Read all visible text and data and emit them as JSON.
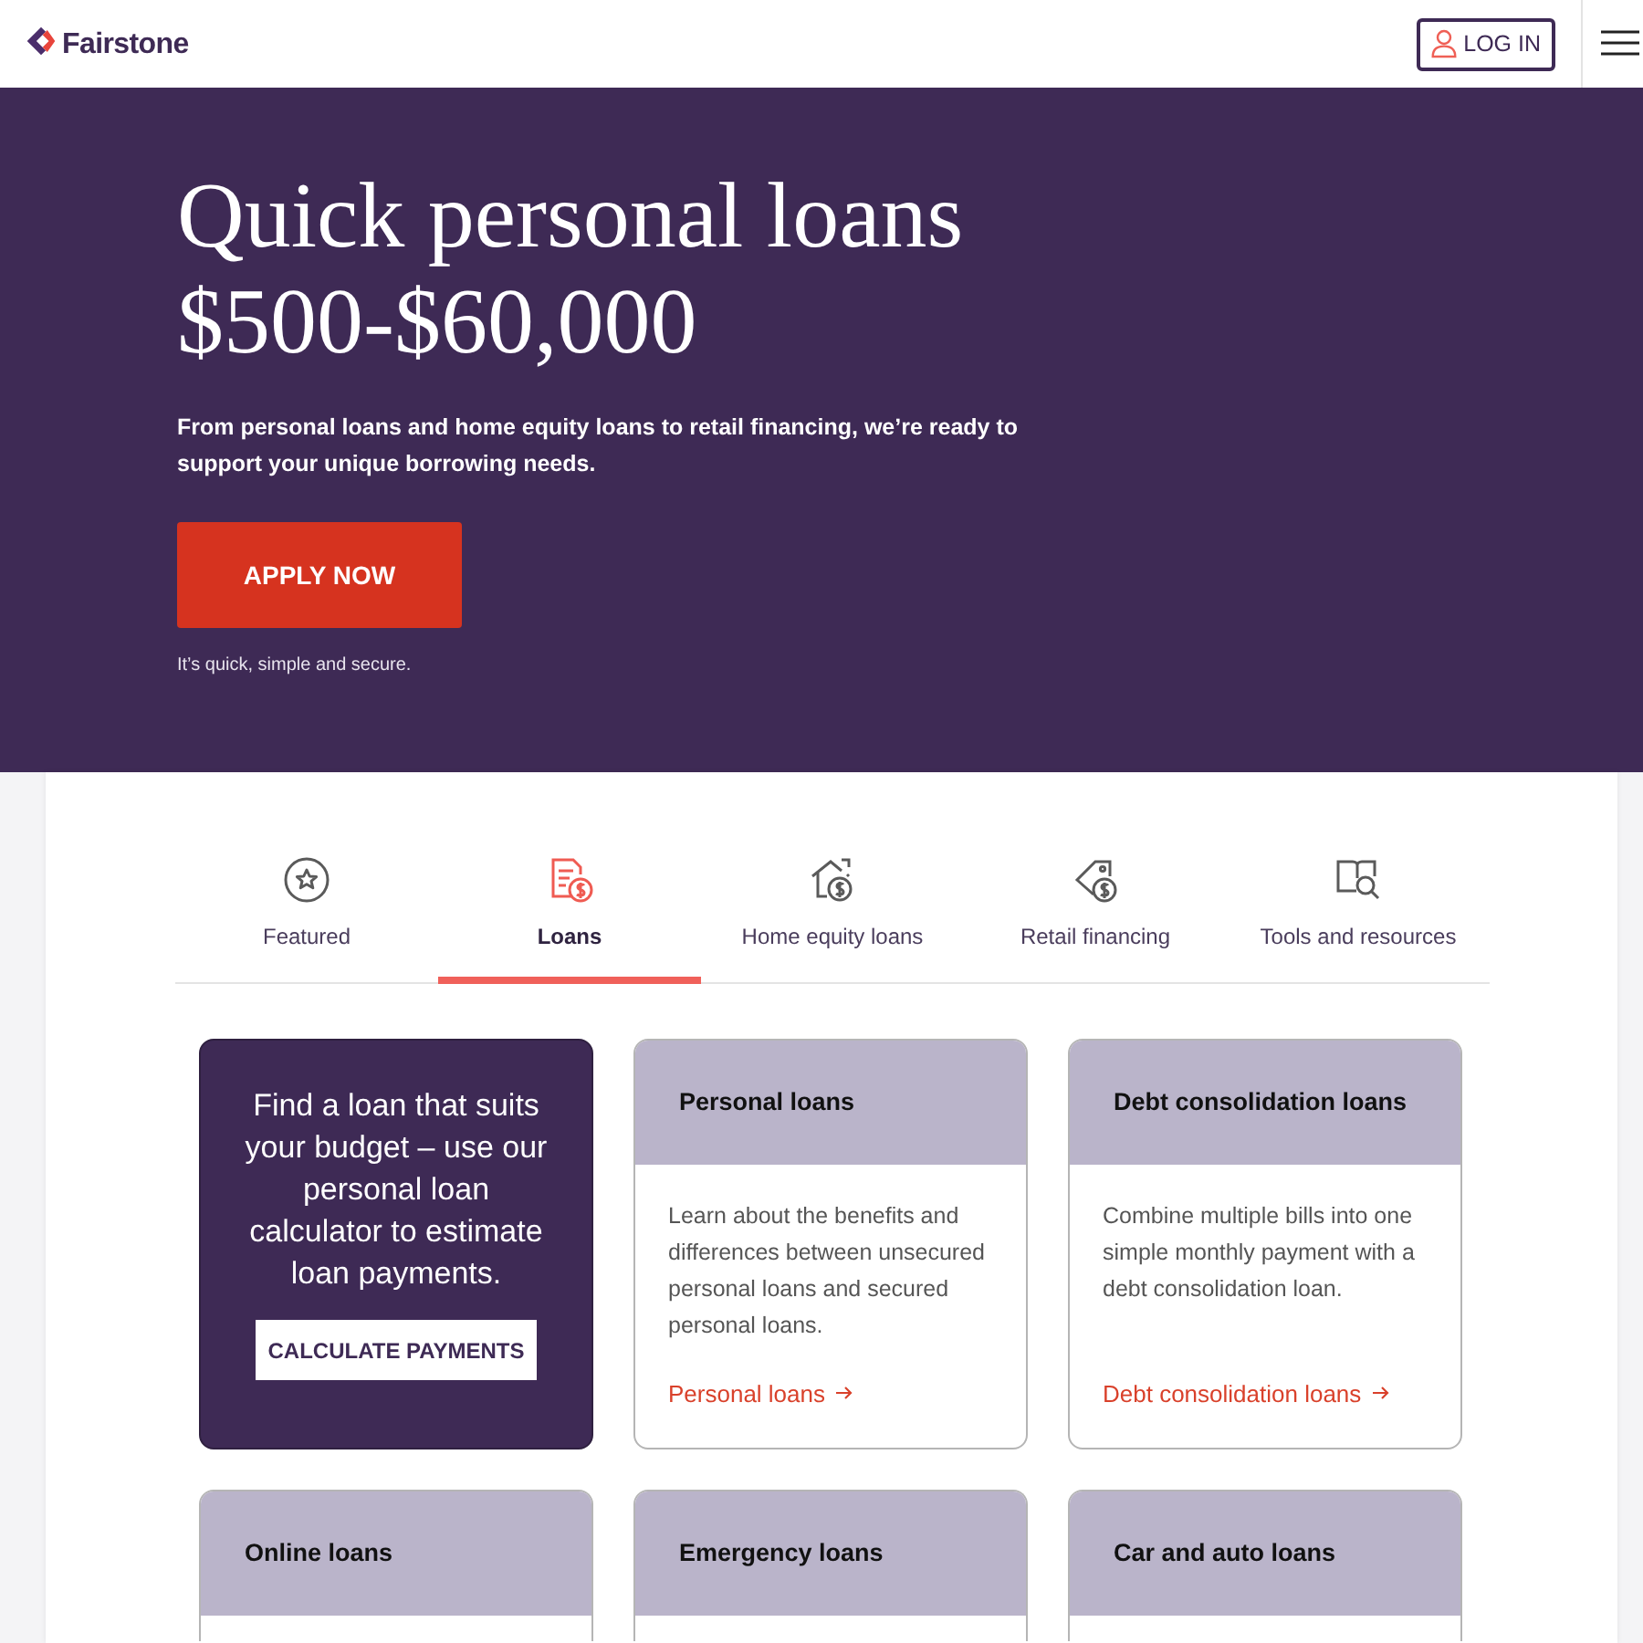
{
  "header": {
    "logo": "Fairstone",
    "login_button": "LOG IN"
  },
  "hero": {
    "title_lines": [
      "Quick personal loans",
      "$500-$60,000"
    ],
    "description": "From personal loans and home equity loans to retail financing, we’re ready to support your unique borrowing needs.",
    "button": "APPLY NOW",
    "note": "It’s quick, simple and secure."
  },
  "tabs": [
    {
      "label": "Featured",
      "selected": false
    },
    {
      "label": "Loans",
      "selected": true
    },
    {
      "label": "Home equity loans",
      "selected": false
    },
    {
      "label": "Retail financing",
      "selected": false
    },
    {
      "label": "Tools and resources",
      "selected": false
    }
  ],
  "promo_card": {
    "text": "Find a loan that suits your budget – use our personal loan calculator to estimate loan payments.",
    "button": "CALCULATE PAYMENTS"
  },
  "cards": [
    {
      "title": "Personal loans",
      "description": "Learn about the benefits and differences between unsecured personal loans and secured personal loans.",
      "link": "Personal loans"
    },
    {
      "title": "Debt consolidation loans",
      "description": "Combine multiple bills into one simple monthly payment with a debt consolidation loan.",
      "link": "Debt consolidation loans"
    },
    {
      "title": "Online loans"
    },
    {
      "title": "Emergency loans"
    },
    {
      "title": "Car and auto loans"
    }
  ]
}
